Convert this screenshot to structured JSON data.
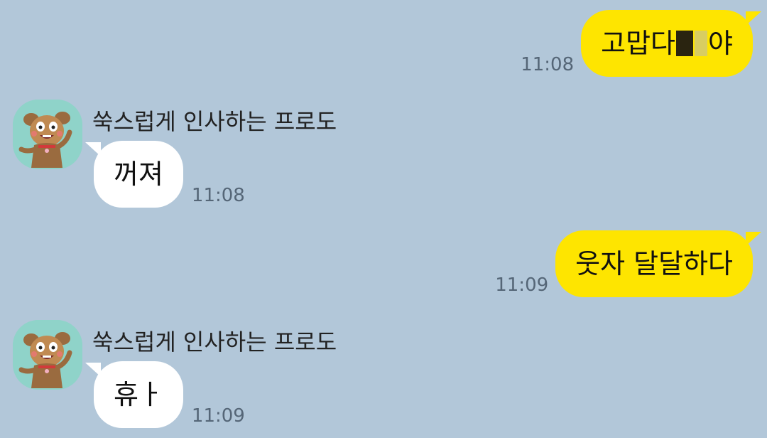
{
  "messages": [
    {
      "direction": "outgoing",
      "text_before": "고맙다 ",
      "text_after": "야",
      "time": "11:08"
    },
    {
      "direction": "incoming",
      "sender": "쑥스럽게 인사하는 프로도",
      "text": "꺼져",
      "time": "11:08"
    },
    {
      "direction": "outgoing",
      "text": "웃자 달달하다",
      "time": "11:09"
    },
    {
      "direction": "incoming",
      "sender": "쑥스럽게 인사하는 프로도",
      "text": "휴ㅏ",
      "time": "11:09"
    }
  ],
  "colors": {
    "background": "#b2c7d9",
    "outgoing_bubble": "#fee500",
    "incoming_bubble": "#ffffff",
    "avatar_bg": "#8fd3c9"
  },
  "icons": {
    "avatar": "frodo-dog-character-icon"
  }
}
